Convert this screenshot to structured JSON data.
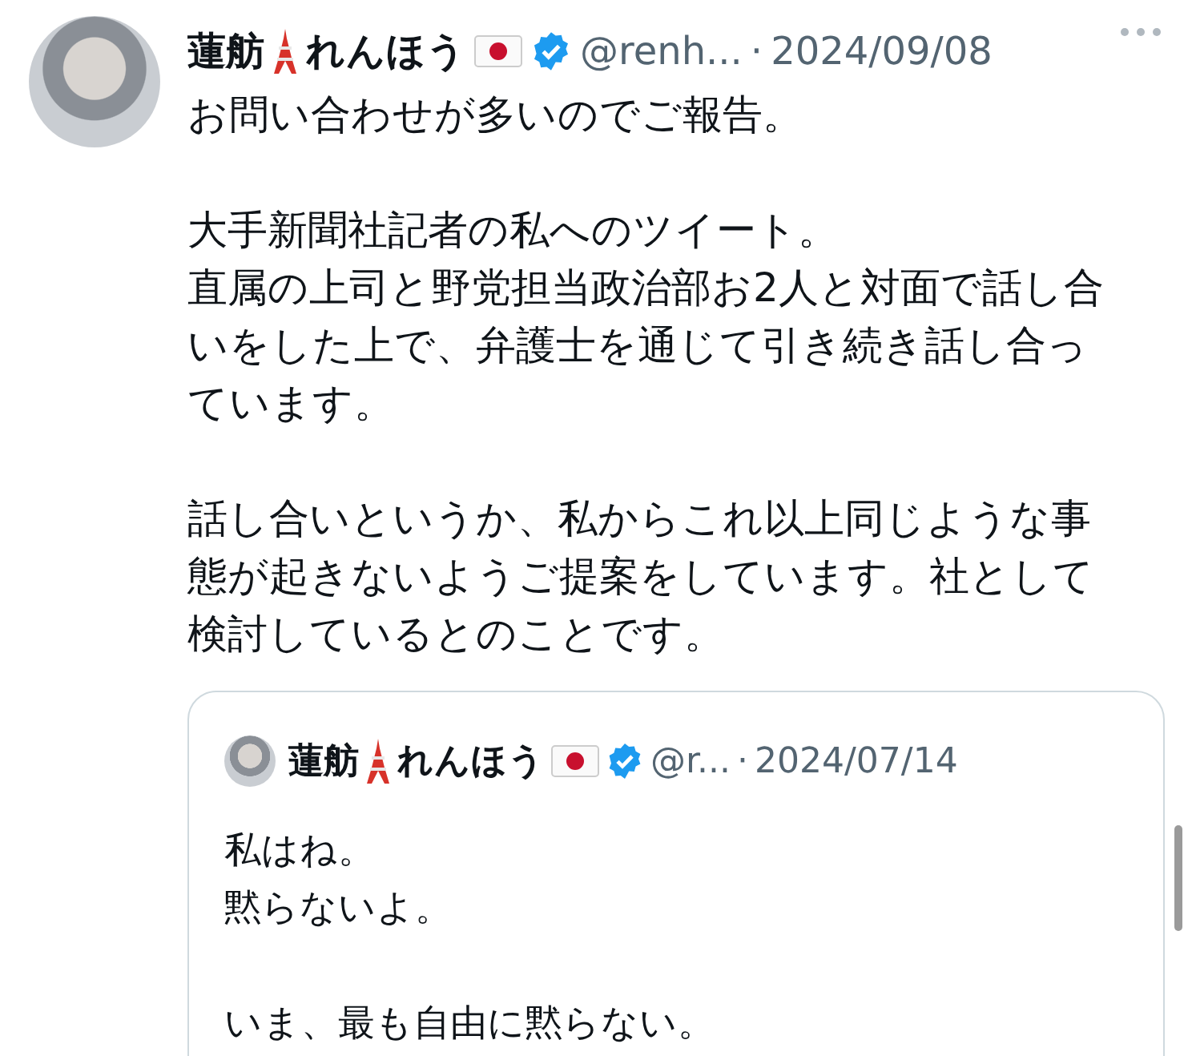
{
  "tweet": {
    "author": {
      "name": [
        "蓮舫",
        "れんほう"
      ],
      "verified": true,
      "handle": "@renh...",
      "separator": "·",
      "date": "2024/09/08"
    },
    "paragraphs": [
      {
        "lines": [
          "お問い合わせが多いのでご報告。"
        ]
      },
      {
        "lines": [
          "大手新聞社記者の私へのツイート。",
          "直属の上司と野党担当政治部お2人と対面で話し合",
          "いをした上で、弁護士を通じて引き続き話し合っ",
          "ています。"
        ]
      },
      {
        "lines": [
          "話し合いというか、私からこれ以上同じような事",
          "態が起きないようご提案をしています。社として",
          "検討しているとのことです。"
        ]
      }
    ],
    "quote": {
      "author": {
        "name": [
          "蓮舫",
          "れんほう"
        ],
        "verified": true,
        "handle": "@r...",
        "separator": "·",
        "date": "2024/07/14"
      },
      "paragraphs": [
        {
          "lines": [
            "私はね。",
            "黙らないよ。"
          ]
        },
        {
          "lines": [
            "いま、最も自由に黙らない。"
          ]
        }
      ]
    }
  }
}
